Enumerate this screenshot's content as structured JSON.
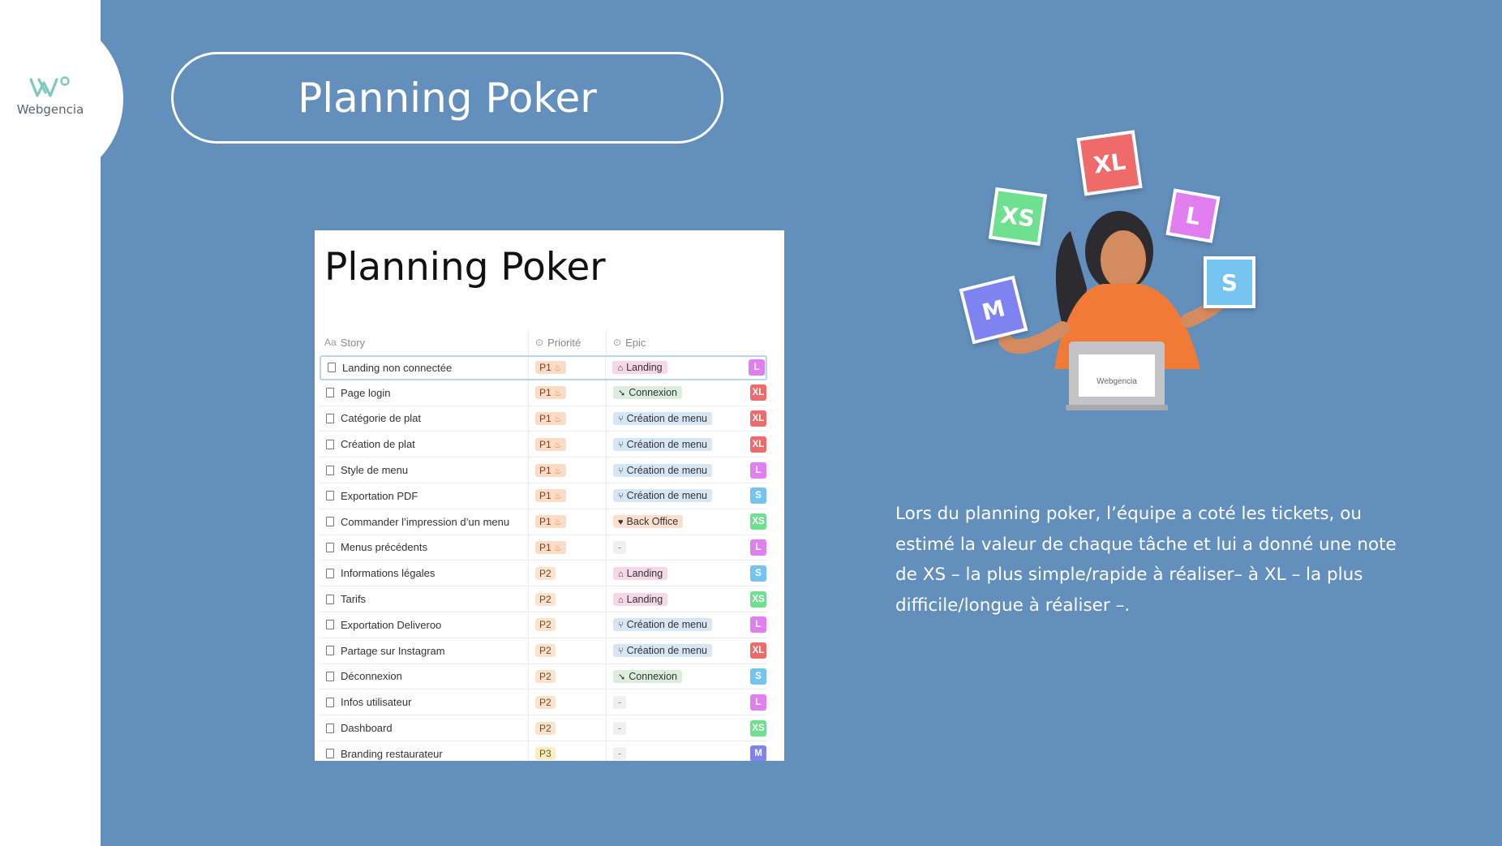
{
  "brand": {
    "name": "Webgencia"
  },
  "slide": {
    "title": "Planning Poker",
    "description": "Lors du planning poker, l’équipe a coté les tickets, ou estimé la valeur de chaque tâche et lui a donné une note de XS – la plus simple/rapide à réaliser– à XL – la plus difficile/longue à réaliser –."
  },
  "table_screenshot": {
    "title": "Planning Poker",
    "columns": {
      "story": "Story",
      "priority": "Priorité",
      "epic": "Epic"
    },
    "column_icons": {
      "story": "Aa",
      "priority": "⊙",
      "epic": "⊙"
    },
    "rows": [
      {
        "story": "Landing non connectée",
        "priority": "P1",
        "hot": true,
        "epic": "Landing",
        "epic_type": "landing",
        "size": "L"
      },
      {
        "story": "Page login",
        "priority": "P1",
        "hot": true,
        "epic": "Connexion",
        "epic_type": "connexion",
        "size": "XL"
      },
      {
        "story": "Catégorie de plat",
        "priority": "P1",
        "hot": true,
        "epic": "Création de menu",
        "epic_type": "menu",
        "size": "XL"
      },
      {
        "story": "Création de plat",
        "priority": "P1",
        "hot": true,
        "epic": "Création de menu",
        "epic_type": "menu",
        "size": "XL"
      },
      {
        "story": "Style de menu",
        "priority": "P1",
        "hot": true,
        "epic": "Création de menu",
        "epic_type": "menu",
        "size": "L"
      },
      {
        "story": "Exportation PDF",
        "priority": "P1",
        "hot": true,
        "epic": "Création de menu",
        "epic_type": "menu",
        "size": "S"
      },
      {
        "story": "Commander l’impression d’un menu",
        "priority": "P1",
        "hot": true,
        "epic": "Back Office",
        "epic_type": "backoffice",
        "size": "XS"
      },
      {
        "story": "Menus précédents",
        "priority": "P1",
        "hot": true,
        "epic": "-",
        "epic_type": "empty",
        "size": "L"
      },
      {
        "story": "Informations légales",
        "priority": "P2",
        "hot": false,
        "epic": "Landing",
        "epic_type": "landing",
        "size": "S"
      },
      {
        "story": "Tarifs",
        "priority": "P2",
        "hot": false,
        "epic": "Landing",
        "epic_type": "landing",
        "size": "XS"
      },
      {
        "story": "Exportation Deliveroo",
        "priority": "P2",
        "hot": false,
        "epic": "Création de menu",
        "epic_type": "menu",
        "size": "L"
      },
      {
        "story": "Partage sur Instagram",
        "priority": "P2",
        "hot": false,
        "epic": "Création de menu",
        "epic_type": "menu",
        "size": "XL"
      },
      {
        "story": "Déconnexion",
        "priority": "P2",
        "hot": false,
        "epic": "Connexion",
        "epic_type": "connexion",
        "size": "S"
      },
      {
        "story": "Infos utilisateur",
        "priority": "P2",
        "hot": false,
        "epic": "-",
        "epic_type": "empty",
        "size": "L"
      },
      {
        "story": "Dashboard",
        "priority": "P2",
        "hot": false,
        "epic": "-",
        "epic_type": "empty",
        "size": "XS"
      },
      {
        "story": "Branding restaurateur",
        "priority": "P3",
        "hot": false,
        "epic": "-",
        "epic_type": "empty",
        "size": "M"
      }
    ]
  },
  "size_colors": {
    "XS": "#6ee08f",
    "S": "#74c4ef",
    "M": "#7f83f2",
    "L": "#e27ff0",
    "XL": "#ef6a6a"
  },
  "epic_icons": {
    "landing": "⌂",
    "connexion": "➘",
    "menu": "⑂",
    "backoffice": "♥",
    "empty": ""
  },
  "illustration": {
    "cards": [
      "XL",
      "XS",
      "L",
      "S",
      "M"
    ],
    "laptop_brand": "Webgencia"
  }
}
